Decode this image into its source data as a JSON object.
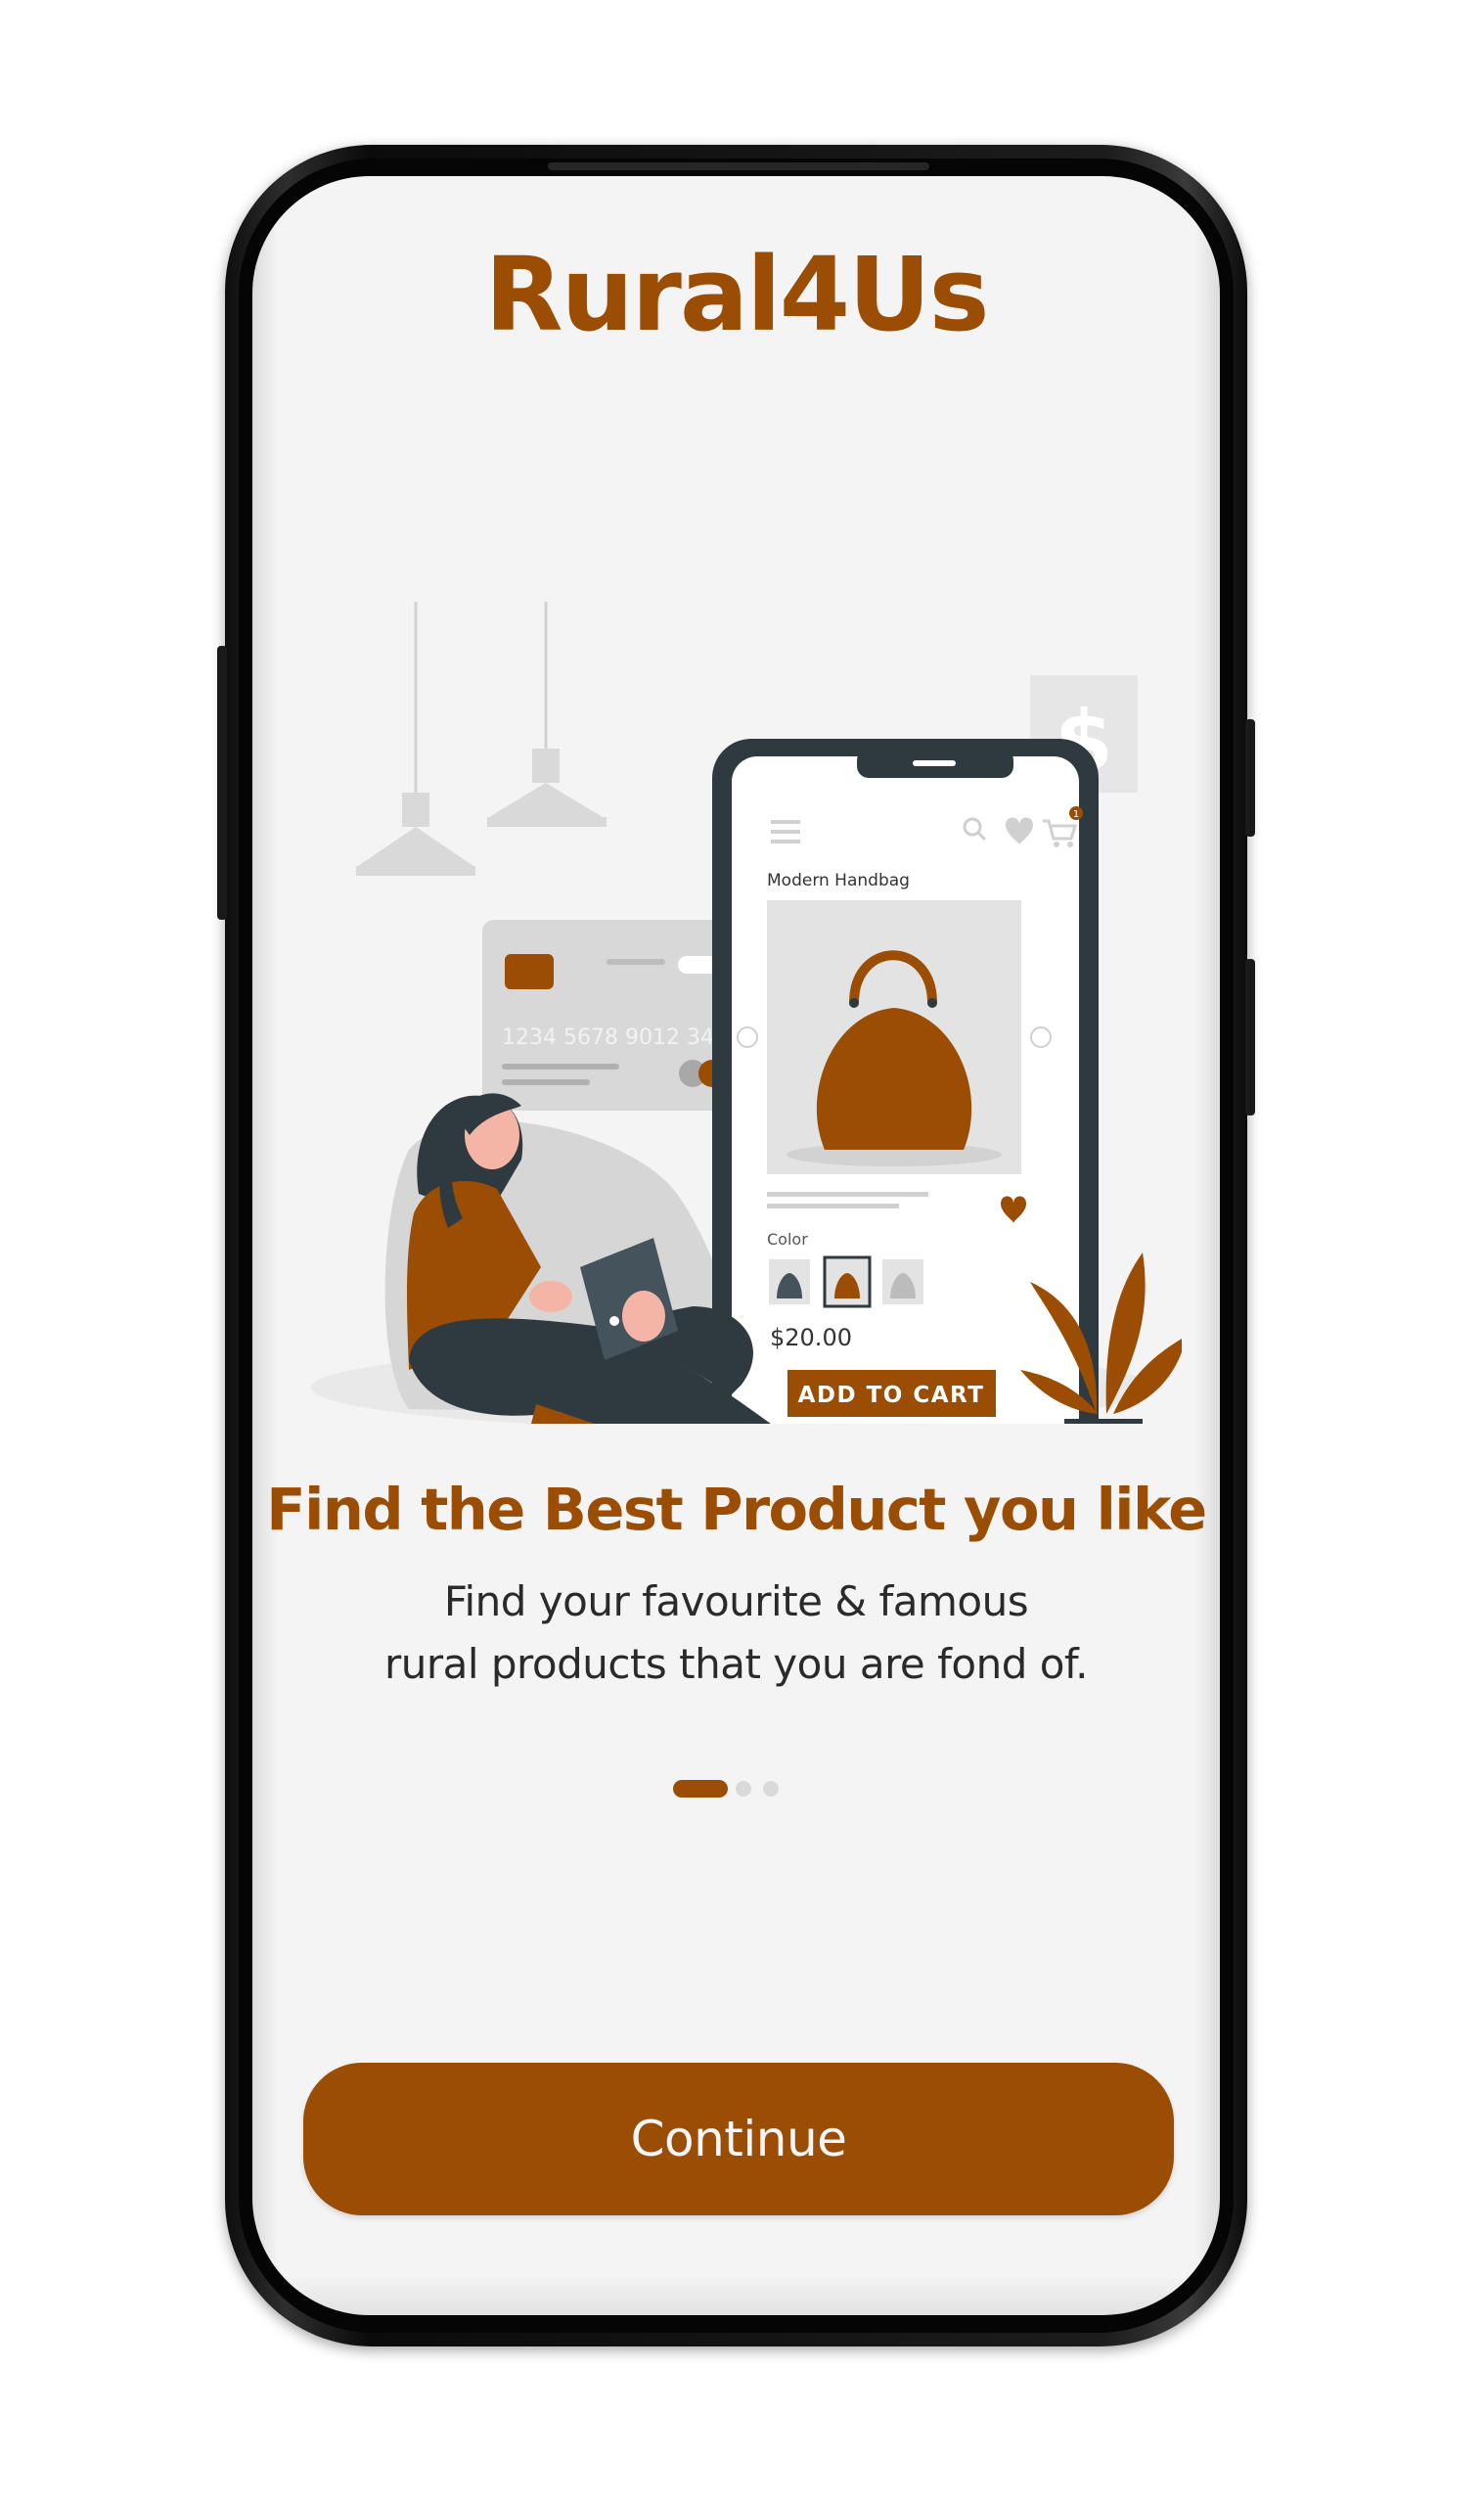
{
  "app": {
    "title": "Rural4Us"
  },
  "onboarding": {
    "headline": "Find the Best Product you like",
    "description_lines": [
      "Find your favourite & famous",
      "rural products that you are fond of."
    ],
    "page_indicator": {
      "current": 1,
      "total": 3
    },
    "continue_label": "Continue"
  },
  "illustration": {
    "inner_phone": {
      "product_name": "Modern Handbag",
      "color_label": "Color",
      "price": "$20.00",
      "add_to_cart_label": "ADD TO CART",
      "cart_badge": "1"
    },
    "card_number": "1234 5678 9012 345",
    "dollar_sign": "$"
  },
  "colors": {
    "accent": "#9b4d04",
    "background": "#f4f4f4",
    "dark": "#2f3a40",
    "inactive_dot": "#d9d9d9"
  }
}
